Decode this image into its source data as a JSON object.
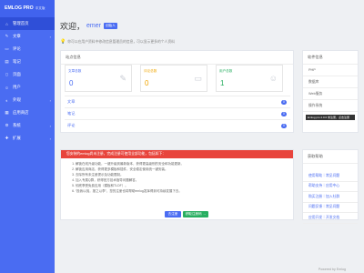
{
  "brand": {
    "name": "EMLOG PRO",
    "tag": "中文版"
  },
  "sidebar": {
    "items": [
      {
        "label": "管理首页",
        "icon": "home-icon",
        "active": true,
        "chevron": false
      },
      {
        "label": "文章",
        "icon": "edit-icon",
        "active": false,
        "chevron": true
      },
      {
        "label": "评论",
        "icon": "comment-icon",
        "active": false,
        "chevron": false
      },
      {
        "label": "笔记",
        "icon": "note-icon",
        "active": false,
        "chevron": false
      },
      {
        "label": "页面",
        "icon": "page-icon",
        "active": false,
        "chevron": false
      },
      {
        "label": "用户",
        "icon": "user-icon",
        "active": false,
        "chevron": false
      },
      {
        "label": "外观",
        "icon": "palette-icon",
        "active": false,
        "chevron": true
      },
      {
        "label": "应用商店",
        "icon": "store-icon",
        "active": false,
        "chevron": false
      },
      {
        "label": "系统",
        "icon": "settings-icon",
        "active": false,
        "chevron": true
      },
      {
        "label": "扩展",
        "icon": "plugin-icon",
        "active": false,
        "chevron": true
      }
    ]
  },
  "header": {
    "welcome": "欢迎，",
    "username": "emer",
    "role_badge": "创始人"
  },
  "tip": {
    "text": "你可以在用户资料中修改信息管理员的信息，可以显示更多的个人资料"
  },
  "site_info": {
    "title": "站点信息",
    "stats": [
      {
        "label": "文章总数",
        "value": "0",
        "color": "#4a6cf2",
        "icon": "pencil-icon"
      },
      {
        "label": "评论总数",
        "value": "0",
        "color": "#f0a500",
        "icon": "chat-icon"
      },
      {
        "label": "用户总数",
        "value": "1",
        "color": "#27ae60",
        "icon": "person-icon"
      }
    ],
    "rows": [
      {
        "label": "文章",
        "count": "0"
      },
      {
        "label": "笔记",
        "count": "0"
      },
      {
        "label": "评论",
        "count": "0"
      }
    ]
  },
  "software": {
    "title": "软件信息",
    "items": [
      "PHP",
      "数据库",
      "Web服务",
      "操作系统"
    ],
    "version_badge": "Emlog pro 2.0.0 未注册，点击注册"
  },
  "alert": {
    "header": "您安装的emlog尚未注册，完成注册可使用全部功能，包括如下：",
    "items": [
      "解锁在线升级功能，一键升级到最新版本，获得更高级别的安全和功能更新。",
      "解锁应用商店，获得更多模板和插件，安全稳定使用统一键安装。",
      "去除所有未注册提示及功能限制。",
      "加入专属Q群，获得官方技术指导问题解答。",
      "彻底享受免费应用（模板和TLDF）。",
      "“投我以桃，报之以李”，您的注册也将帮助emlog发挥得到可持续发展下去。"
    ],
    "btn_register": "去注册",
    "btn_buy": "获取注册码 →"
  },
  "help": {
    "title": "获取帮助",
    "items": [
      "使用帮助｜常见问题",
      "帮助支持｜应用中心",
      "购买注册｜加入社群",
      "问题反馈｜常见问题",
      "应用开发｜开发文档"
    ]
  },
  "footer": {
    "text": "Powered by Emlog"
  },
  "colors": {
    "primary": "#4a6cf2",
    "danger": "#e8443c",
    "success": "#27ae60",
    "warning": "#f0a500"
  }
}
